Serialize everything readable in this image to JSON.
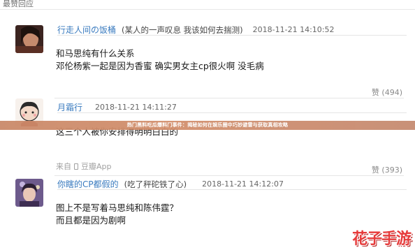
{
  "header": {
    "title": "最赞回应"
  },
  "banner": {
    "text": "热门黑料吃瓜爆料门事件：揭秘如何在娱乐圈中巧妙避雷与获取真相攻略"
  },
  "comments": [
    {
      "username": "行走人间の饭桶",
      "user_note": "(某人的一声叹息 我该如何去揣测)",
      "time": "2018-11-21 14:10:52",
      "lines": [
        "和马思纯有什么关系",
        "邓伦杨紫一起是因为香蜜 确实男女主cp很火啊 没毛病"
      ],
      "likes": "赞 (494)"
    },
    {
      "username": "月霜行",
      "user_note": "",
      "time": "2018-11-21 14:11:27",
      "lines": [
        "这三个人被你安排得明明白白的"
      ],
      "source_prefix": "来自",
      "source_app": "豆瓣App",
      "likes": "赞 (393)"
    },
    {
      "username": "你瞎的CP都假的",
      "user_note": "(吃了秤砣铁了心)",
      "time": "2018-11-21 14:12:07",
      "lines": [
        "图上不是写着马思纯和陈伟霆？",
        "而且都是因为剧啊"
      ],
      "likes": ""
    }
  ],
  "watermark": {
    "text": "花子手游"
  },
  "colors": {
    "link": "#3a7bbf",
    "banner": "#d38f6c",
    "watermark": "#e63b3b"
  }
}
